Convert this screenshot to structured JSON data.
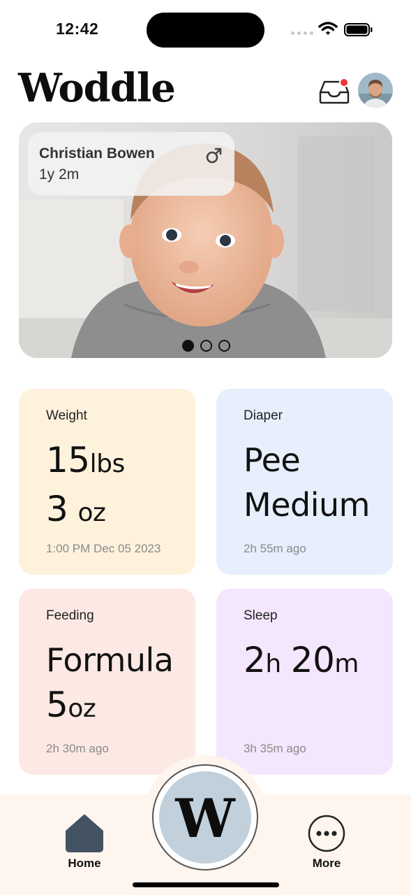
{
  "status_bar": {
    "time": "12:42"
  },
  "header": {
    "app_title": "Woddle",
    "inbox_icon": "inbox-tray-icon",
    "notification_color": "#ee3434"
  },
  "hero": {
    "child_name": "Christian Bowen",
    "child_age": "1y 2m",
    "gender_icon": "male-symbol-icon",
    "pager": {
      "total": 3,
      "active": 1
    }
  },
  "cards": {
    "weight": {
      "label": "Weight",
      "value_major": "15",
      "value_major_unit": "lbs",
      "value_minor": "3",
      "value_minor_unit": "oz",
      "timestamp": "1:00 PM Dec 05 2023",
      "color": "#fef2dd"
    },
    "diaper": {
      "label": "Diaper",
      "type": "Pee",
      "size": "Medium",
      "timestamp": "2h 55m ago",
      "color": "#e7effd"
    },
    "feeding": {
      "label": "Feeding",
      "type": "Formula",
      "amount": "5",
      "amount_unit": "oz",
      "timestamp": "2h 30m ago",
      "color": "#fde9e3"
    },
    "sleep": {
      "label": "Sleep",
      "hours": "2",
      "hours_unit": "h",
      "minutes": "20",
      "minutes_unit": "m",
      "timestamp": "3h 35m ago",
      "color": "#f4e6fc"
    }
  },
  "tab_bar": {
    "home_label": "Home",
    "home_icon": "home-icon",
    "center_letter": "W",
    "more_label": "More",
    "more_icon": "more-dots-icon",
    "background": "#fdf5ee",
    "center_color": "#c1d0db"
  }
}
